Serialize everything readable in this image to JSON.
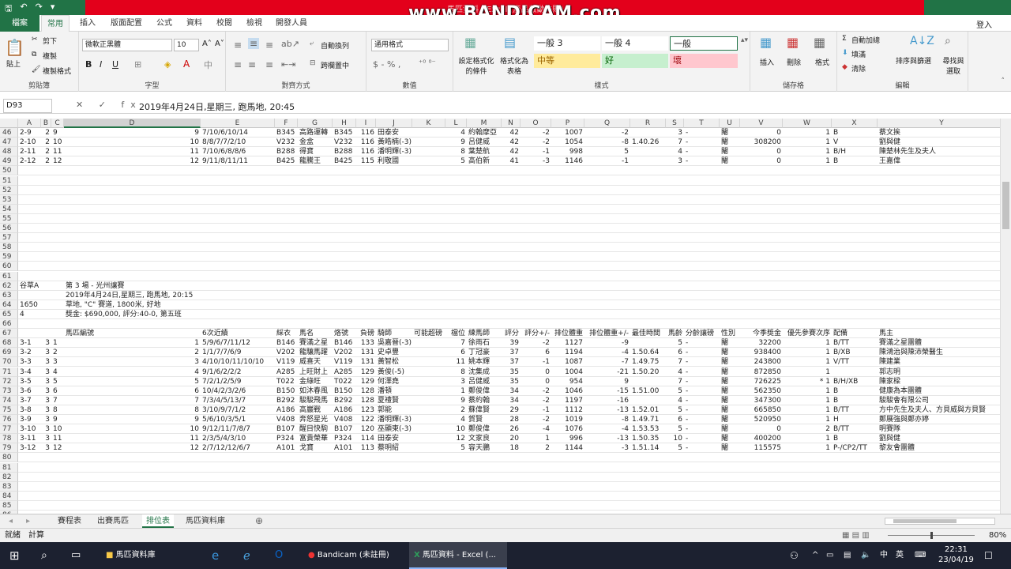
{
  "window": {
    "title": "馬匹資料 - Excel (產品啟動失敗)",
    "watermark": "www.BANDICAM.com"
  },
  "menu": {
    "file": "檔案",
    "tabs": [
      "常用",
      "插入",
      "版面配置",
      "公式",
      "資料",
      "校閱",
      "檢視",
      "開發人員"
    ],
    "login": "登入"
  },
  "ribbon": {
    "clipboard": {
      "cut": "剪下",
      "copy": "複製",
      "painter": "複製格式",
      "paste": "貼上",
      "label": "剪貼簿"
    },
    "font": {
      "name": "微軟正黑體",
      "size": "10",
      "label": "字型",
      "bold": "B",
      "italic": "I",
      "underline": "U"
    },
    "align": {
      "wrap": "自動換列",
      "merge": "跨欄置中",
      "label": "對齊方式"
    },
    "number": {
      "format": "通用格式",
      "label": "數值"
    },
    "styles": {
      "cond": "設定格式化的條件",
      "table": "格式化為表格",
      "items": [
        {
          "text": "一般 3",
          "bg": "#ffffff"
        },
        {
          "text": "一般 4",
          "bg": "#ffffff"
        },
        {
          "text": "一般",
          "bg": "#ffffff"
        },
        {
          "text": "中等",
          "bg": "#ffeb9c"
        },
        {
          "text": "好",
          "bg": "#c6efce"
        },
        {
          "text": "壞",
          "bg": "#ffc7ce"
        }
      ],
      "label": "樣式"
    },
    "cells": {
      "insert": "插入",
      "delete": "刪除",
      "format": "格式",
      "label": "儲存格"
    },
    "editing": {
      "autosum": "自動加總",
      "fill": "填滿",
      "clear": "清除",
      "sort": "排序與篩選",
      "find": "尋找與選取",
      "label": "編輯"
    }
  },
  "formula_bar": {
    "cell": "D93",
    "fx": "✕ ✓ fx",
    "content": "2019年4月24日,星期三, 跑馬地, 20:45"
  },
  "columns": [
    "A",
    "B",
    "C",
    "D",
    "E",
    "F",
    "G",
    "H",
    "I",
    "J",
    "K",
    "L",
    "M",
    "N",
    "O",
    "P",
    "Q",
    "R",
    "S",
    "T",
    "U",
    "V",
    "W",
    "X",
    "Y"
  ],
  "rows": [
    {
      "n": "46",
      "cells": {
        "A": "2-9",
        "B": "2",
        "C": "9",
        "D": "9",
        "E": "7/10/6/10/14",
        "F": "B345",
        "G": "高路運轉",
        "H": "B345",
        "I": "116",
        "J": "田泰安",
        "L": "4",
        "M": "約翰摩亞",
        "N": "42",
        "O": "-2",
        "P": "1007",
        "Q": "-2",
        "S": "3",
        "T": "-",
        "U": "閹",
        "V": "0",
        "W": "1",
        "X": "B",
        "Y": "蔡文挨"
      }
    },
    {
      "n": "47",
      "cells": {
        "A": "2-10",
        "B": "2",
        "C": "10",
        "D": "10",
        "E": "8/8/7/7/2/10",
        "F": "V232",
        "G": "金盒",
        "H": "V232",
        "I": "116",
        "J": "黃皓楠(-3)",
        "L": "9",
        "M": "呂健威",
        "N": "42",
        "O": "-2",
        "P": "1054",
        "Q": "-8",
        "R": "1.40.26",
        "S": "7",
        "T": "-",
        "U": "閹",
        "V": "308200",
        "W": "1",
        "X": "V",
        "Y": "劉與健"
      }
    },
    {
      "n": "48",
      "cells": {
        "A": "2-11",
        "B": "2",
        "C": "11",
        "D": "11",
        "E": "7/10/6/8/8/6",
        "F": "B288",
        "G": "得寶",
        "H": "B288",
        "I": "116",
        "J": "潘明輝(-3)",
        "L": "8",
        "M": "葉楚航",
        "N": "42",
        "O": "-1",
        "P": "998",
        "Q": "5",
        "S": "4",
        "T": "-",
        "U": "閹",
        "V": "0",
        "W": "1",
        "X": "B/H",
        "Y": "陳楚林先生及夫人"
      }
    },
    {
      "n": "49",
      "cells": {
        "A": "2-12",
        "B": "2",
        "C": "12",
        "D": "12",
        "E": "9/11/8/11/11",
        "F": "B425",
        "G": "龍騰王",
        "H": "B425",
        "I": "115",
        "J": "利敬國",
        "L": "5",
        "M": "高伯新",
        "N": "41",
        "O": "-3",
        "P": "1146",
        "Q": "-1",
        "S": "3",
        "T": "-",
        "U": "閹",
        "V": "0",
        "W": "1",
        "X": "B",
        "Y": "王嘉偉"
      }
    },
    {
      "n": "50",
      "cells": {}
    },
    {
      "n": "51",
      "cells": {}
    },
    {
      "n": "52",
      "cells": {}
    },
    {
      "n": "53",
      "cells": {}
    },
    {
      "n": "54",
      "cells": {}
    },
    {
      "n": "55",
      "cells": {}
    },
    {
      "n": "56",
      "cells": {}
    },
    {
      "n": "57",
      "cells": {}
    },
    {
      "n": "58",
      "cells": {}
    },
    {
      "n": "59",
      "cells": {}
    },
    {
      "n": "60",
      "cells": {}
    },
    {
      "n": "61",
      "cells": {}
    },
    {
      "n": "62",
      "cells": {
        "A": "谷草A",
        "D": "第 3 場 - 光州讓賽"
      }
    },
    {
      "n": "63",
      "cells": {
        "D": "2019年4月24日,星期三, 跑馬地, 20:15"
      }
    },
    {
      "n": "64",
      "cells": {
        "A": "1650",
        "D": "草地, \"C\" 賽道, 1800米, 好地"
      }
    },
    {
      "n": "65",
      "cells": {
        "A": "4",
        "D": "獎金: $690,000, 評分:40-0, 第五班"
      }
    },
    {
      "n": "66",
      "cells": {}
    },
    {
      "n": "67",
      "cells": {
        "D": "馬匹編號",
        "E": "6次近績",
        "F": "綵衣",
        "G": "馬名",
        "H": "烙號",
        "I": "負磅",
        "J": "騎師",
        "K": "可能超磅",
        "L": "檔位",
        "M": "練馬師",
        "N": "評分",
        "O": "評分+/-",
        "P": "排位體重",
        "Q": "排位體重+/-",
        "R": "最佳時間",
        "S": "馬齡",
        "T": "分齡讓磅",
        "U": "性別",
        "V": "今季獎金",
        "W": "優先參賽次序",
        "X": "配備",
        "Y": "馬主"
      }
    },
    {
      "n": "68",
      "cells": {
        "A": "3-1",
        "B": "3",
        "C": "1",
        "D": "1",
        "E": "5/9/6/7/11/12",
        "F": "B146",
        "G": "賽滿之星",
        "H": "B146",
        "I": "133",
        "J": "吳嘉晉(-3)",
        "L": "7",
        "M": "徐雨石",
        "N": "39",
        "O": "-2",
        "P": "1127",
        "Q": "-9",
        "S": "5",
        "T": "-",
        "U": "閹",
        "V": "32200",
        "W": "1",
        "X": "B/TT",
        "Y": "賽滿之星團體"
      }
    },
    {
      "n": "69",
      "cells": {
        "A": "3-2",
        "B": "3",
        "C": "2",
        "D": "2",
        "E": "1/1/7/7/6/9",
        "F": "V202",
        "G": "龍驤馬躍",
        "H": "V202",
        "I": "131",
        "J": "史卓豐",
        "L": "6",
        "M": "丁冠豪",
        "N": "37",
        "O": "6",
        "P": "1194",
        "Q": "-4",
        "R": "1.50.64",
        "S": "6",
        "T": "-",
        "U": "閹",
        "V": "938400",
        "W": "1",
        "X": "B/XB",
        "Y": "陳鴻治與陳沛榮醫生"
      }
    },
    {
      "n": "70",
      "cells": {
        "A": "3-3",
        "B": "3",
        "C": "3",
        "D": "3",
        "E": "4/10/10/11/10/10",
        "F": "V119",
        "G": "威喜天",
        "H": "V119",
        "I": "131",
        "J": "黃智松",
        "L": "11",
        "M": "姚本輝",
        "N": "37",
        "O": "-1",
        "P": "1087",
        "Q": "-7",
        "R": "1.49.75",
        "S": "7",
        "T": "-",
        "U": "閹",
        "V": "243800",
        "W": "1",
        "X": "V/TT",
        "Y": "陳建業"
      }
    },
    {
      "n": "71",
      "cells": {
        "A": "3-4",
        "B": "3",
        "C": "4",
        "D": "4",
        "E": "9/1/6/2/2/2",
        "F": "A285",
        "G": "上旺財上",
        "H": "A285",
        "I": "129",
        "J": "黃俊(-5)",
        "L": "8",
        "M": "沈集成",
        "N": "35",
        "O": "0",
        "P": "1004",
        "Q": "-21",
        "R": "1.50.20",
        "S": "4",
        "T": "-",
        "U": "閹",
        "V": "872850",
        "W": "1",
        "Y": "郭志明"
      }
    },
    {
      "n": "72",
      "cells": {
        "A": "3-5",
        "B": "3",
        "C": "5",
        "D": "5",
        "E": "7/2/1/2/5/9",
        "F": "T022",
        "G": "金綠旺",
        "H": "T022",
        "I": "129",
        "J": "何澤堯",
        "L": "3",
        "M": "呂健威",
        "N": "35",
        "O": "0",
        "P": "954",
        "Q": "9",
        "S": "7",
        "T": "-",
        "U": "閹",
        "V": "726225",
        "W": "* 1",
        "X": "B/H/XB",
        "Y": "陳家樑"
      }
    },
    {
      "n": "73",
      "cells": {
        "A": "3-6",
        "B": "3",
        "C": "6",
        "D": "6",
        "E": "10/4/2/3/2/6",
        "F": "B150",
        "G": "如沐春風",
        "H": "B150",
        "I": "128",
        "J": "潘頓",
        "L": "1",
        "M": "鄭俊偉",
        "N": "34",
        "O": "-2",
        "P": "1046",
        "Q": "-15",
        "R": "1.51.00",
        "S": "5",
        "T": "-",
        "U": "閹",
        "V": "562350",
        "W": "1",
        "X": "B",
        "Y": "健康為本團體"
      }
    },
    {
      "n": "74",
      "cells": {
        "A": "3-7",
        "B": "3",
        "C": "7",
        "D": "7",
        "E": "7/3/4/5/13/7",
        "F": "B292",
        "G": "駿駿飛馬",
        "H": "B292",
        "I": "128",
        "J": "夏禮賢",
        "L": "9",
        "M": "蔡約翰",
        "N": "34",
        "O": "-2",
        "P": "1197",
        "Q": "-16",
        "S": "4",
        "T": "-",
        "U": "閹",
        "V": "347300",
        "W": "1",
        "X": "B",
        "Y": "駿駿會有限公司"
      }
    },
    {
      "n": "75",
      "cells": {
        "A": "3-8",
        "B": "3",
        "C": "8",
        "D": "8",
        "E": "3/10/9/7/1/2",
        "F": "A186",
        "G": "高巖戰",
        "H": "A186",
        "I": "123",
        "J": "郭能",
        "L": "2",
        "M": "蘇偉賢",
        "N": "29",
        "O": "-1",
        "P": "1112",
        "Q": "-13",
        "R": "1.52.01",
        "S": "5",
        "T": "-",
        "U": "閹",
        "V": "665850",
        "W": "1",
        "X": "B/TT",
        "Y": "方中先生及夫人、方貝威與方貝賢"
      }
    },
    {
      "n": "76",
      "cells": {
        "A": "3-9",
        "B": "3",
        "C": "9",
        "D": "9",
        "E": "5/6/10/3/5/1",
        "F": "V408",
        "G": "奔怒星光",
        "H": "V408",
        "I": "122",
        "J": "潘明輝(-3)",
        "L": "4",
        "M": "賀賢",
        "N": "28",
        "O": "-2",
        "P": "1019",
        "Q": "-8",
        "R": "1.49.71",
        "S": "6",
        "T": "-",
        "U": "閹",
        "V": "520950",
        "W": "1",
        "X": "H",
        "Y": "鄭展強與鄭亦婷"
      }
    },
    {
      "n": "77",
      "cells": {
        "A": "3-10",
        "B": "3",
        "C": "10",
        "D": "10",
        "E": "9/12/11/7/8/7",
        "F": "B107",
        "G": "醒目快駒",
        "H": "B107",
        "I": "120",
        "J": "巫顯東(-3)",
        "L": "10",
        "M": "鄭俊偉",
        "N": "26",
        "O": "-4",
        "P": "1076",
        "Q": "-4",
        "R": "1.53.53",
        "S": "5",
        "T": "-",
        "U": "閹",
        "V": "0",
        "W": "2",
        "X": "B/TT",
        "Y": "明賽隊"
      }
    },
    {
      "n": "78",
      "cells": {
        "A": "3-11",
        "B": "3",
        "C": "11",
        "D": "11",
        "E": "2/3/5/4/3/10",
        "F": "P324",
        "G": "富貴榮華",
        "H": "P324",
        "I": "114",
        "J": "田泰安",
        "L": "12",
        "M": "文家良",
        "N": "20",
        "O": "1",
        "P": "996",
        "Q": "-13",
        "R": "1.50.35",
        "S": "10",
        "T": "-",
        "U": "閹",
        "V": "400200",
        "W": "1",
        "X": "B",
        "Y": "劉與健"
      }
    },
    {
      "n": "79",
      "cells": {
        "A": "3-12",
        "B": "3",
        "C": "12",
        "D": "12",
        "E": "2/7/12/12/6/7",
        "F": "A101",
        "G": "戈寶",
        "H": "A101",
        "I": "113",
        "J": "蔡明紹",
        "L": "5",
        "M": "容天鵬",
        "N": "18",
        "O": "2",
        "P": "1144",
        "Q": "-3",
        "R": "1.51.14",
        "S": "5",
        "T": "-",
        "U": "閹",
        "V": "115575",
        "W": "1",
        "X": "P-/CP2/TT",
        "Y": "黎友會團體"
      }
    },
    {
      "n": "80",
      "cells": {}
    },
    {
      "n": "81",
      "cells": {}
    },
    {
      "n": "82",
      "cells": {}
    },
    {
      "n": "83",
      "cells": {}
    },
    {
      "n": "84",
      "cells": {}
    },
    {
      "n": "85",
      "cells": {}
    },
    {
      "n": "86",
      "cells": {}
    }
  ],
  "sheets": [
    "賽程表",
    "出賽馬匹",
    "排位表",
    "馬匹資料庫"
  ],
  "active_sheet": "排位表",
  "status": {
    "ready": "就緒",
    "calc": "計算",
    "zoom": "80%"
  },
  "taskbar": {
    "items": [
      "馬匹資料庫",
      "Bandicam (未註冊)",
      "馬匹資料 - Excel (..."
    ],
    "time": "22:31",
    "date": "23/04/19",
    "ime": "英"
  }
}
